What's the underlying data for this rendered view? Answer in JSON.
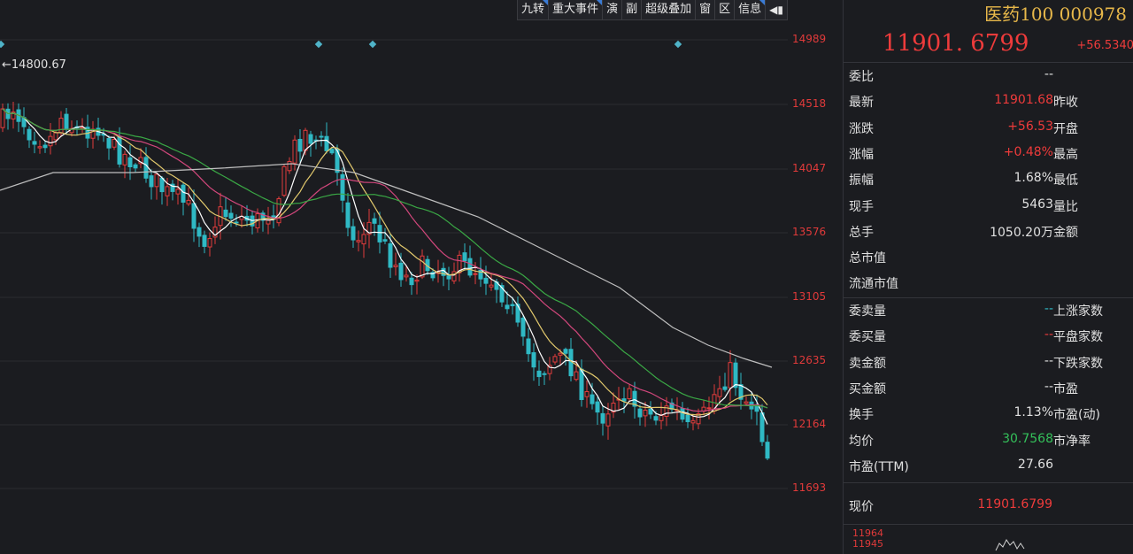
{
  "toolbar": {
    "items": [
      {
        "label": "九转",
        "flag": true
      },
      {
        "label": "重大事件",
        "flag": true
      },
      {
        "label": "演",
        "flag": false
      },
      {
        "label": "副",
        "flag": false
      },
      {
        "label": "超级叠加",
        "flag": false
      },
      {
        "label": "窗",
        "flag": false
      },
      {
        "label": "区",
        "flag": false
      },
      {
        "label": "信息",
        "flag": true
      }
    ],
    "pin_icon": "pin-icon"
  },
  "chart": {
    "max_label": "14800.67",
    "price_ticks": [
      "14989",
      "14518",
      "14047",
      "13576",
      "13105",
      "12635",
      "12164",
      "11693"
    ],
    "colors": {
      "up": "#e23c3c",
      "down": "#2fb9c4",
      "ma5": "#ffffff",
      "ma10": "#e2c96d",
      "ma20": "#d2477c",
      "ma30": "#3aa845",
      "ma60": "#bfbfbf"
    }
  },
  "quote": {
    "name": "医药100 000978",
    "price": "11901. 6799",
    "change": "+56.5340",
    "rows": [
      {
        "label": "委比",
        "value": "--",
        "right_label": ""
      },
      {
        "label": "最新",
        "value": "11901.68",
        "value_color": "red",
        "right_label": "昨收"
      },
      {
        "label": "涨跌",
        "value": "+56.53",
        "value_color": "red",
        "right_label": "开盘"
      },
      {
        "label": "涨幅",
        "value": "+0.48%",
        "value_color": "red",
        "right_label": "最高"
      },
      {
        "label": "振幅",
        "value": "1.68%",
        "right_label": "最低"
      },
      {
        "label": "现手",
        "value": "5463",
        "right_label": "量比"
      },
      {
        "label": "总手",
        "value": "1050.20万",
        "right_label": "金额"
      },
      {
        "label": "总市值",
        "value": "",
        "right_label": ""
      },
      {
        "label": "流通市值",
        "value": "",
        "right_label": ""
      }
    ],
    "rows2": [
      {
        "label": "委卖量",
        "value": "--",
        "value_color": "cyan",
        "right_label": "上涨家数"
      },
      {
        "label": "委买量",
        "value": "--",
        "value_color": "red",
        "right_label": "平盘家数"
      },
      {
        "label": "卖金额",
        "value": "--",
        "right_label": "下跌家数"
      },
      {
        "label": "买金额",
        "value": "--",
        "right_label": "市盈"
      },
      {
        "label": "换手",
        "value": "1.13%",
        "right_label": "市盈(动)"
      },
      {
        "label": "均价",
        "value": "30.7568",
        "value_color": "green",
        "right_label": "市净率"
      },
      {
        "label": "市盈(TTM)",
        "value": "27.66",
        "right_label": ""
      }
    ],
    "now_label": "现价",
    "now_value": "11901.6799",
    "mini_ticks": [
      "11964",
      "11945"
    ]
  }
}
